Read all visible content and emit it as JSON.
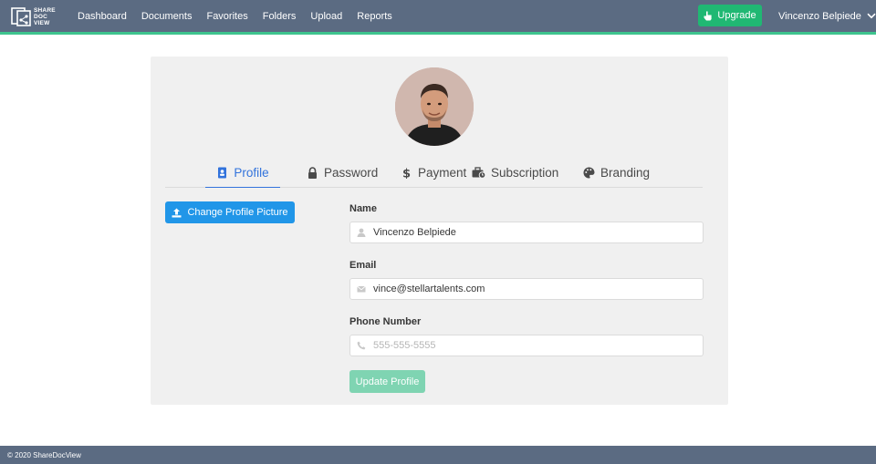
{
  "brand": {
    "logo_text": [
      "SHARE",
      "DOC",
      "VIEW"
    ]
  },
  "nav": {
    "items": [
      {
        "label": "Dashboard"
      },
      {
        "label": "Documents"
      },
      {
        "label": "Favorites"
      },
      {
        "label": "Folders"
      },
      {
        "label": "Upload"
      },
      {
        "label": "Reports"
      }
    ],
    "upgrade_label": "Upgrade",
    "user_name": "Vincenzo Belpiede"
  },
  "tabs": [
    {
      "label": "Profile",
      "icon": "id-badge-icon",
      "active": true
    },
    {
      "label": "Password",
      "icon": "lock-icon",
      "active": false
    },
    {
      "label": "Payment",
      "icon": "dollar-icon",
      "active": false
    },
    {
      "label": "Subscription",
      "icon": "briefcase-clock-icon",
      "active": false
    },
    {
      "label": "Branding",
      "icon": "palette-icon",
      "active": false
    }
  ],
  "profile": {
    "change_picture_label": "Change Profile Picture",
    "name_label": "Name",
    "name_value": "Vincenzo Belpiede",
    "email_label": "Email",
    "email_value": "vince@stellartalents.com",
    "phone_label": "Phone Number",
    "phone_value": "",
    "phone_placeholder": "555-555-5555",
    "update_label": "Update Profile"
  },
  "footer": {
    "copyright": "© 2020 ShareDocView"
  },
  "colors": {
    "topbar": "#5b6b82",
    "accent_green": "#3ec48e",
    "upgrade": "#20b873",
    "primary_blue": "#2196e8",
    "tab_active": "#3273dc",
    "update_disabled": "#7fd4b2"
  }
}
